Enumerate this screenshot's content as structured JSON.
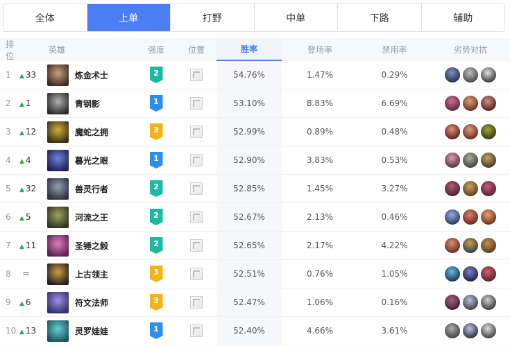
{
  "tabs": [
    {
      "label": "全体",
      "active": false
    },
    {
      "label": "上单",
      "active": true
    },
    {
      "label": "打野",
      "active": false
    },
    {
      "label": "中单",
      "active": false
    },
    {
      "label": "下路",
      "active": false
    },
    {
      "label": "辅助",
      "active": false
    }
  ],
  "headers": {
    "rank": "排位",
    "hero": "英雄",
    "tier": "强度",
    "position": "位置",
    "winrate": "胜率",
    "pickrate": "登场率",
    "banrate": "禁用率",
    "counters": "劣势对抗"
  },
  "colors": {
    "accent": "#4b7ef0",
    "tier1": "#2b8ff0",
    "tier2": "#1fb8a3",
    "tier3": "#f2b21a",
    "trend_up": "#2aa853"
  },
  "rows": [
    {
      "rank": "1",
      "trend": "up",
      "change": "33",
      "name": "炼金术士",
      "tier": "2",
      "winrate": "54.76%",
      "pickrate": "1.47%",
      "banrate": "0.29%",
      "avatar_colors": [
        "#3a2a2a",
        "#c9a27a"
      ],
      "counter_colors": [
        [
          "#2a3050",
          "#8090c0"
        ],
        [
          "#4a4a4a",
          "#c0c0c0"
        ],
        [
          "#3b3b3b",
          "#e0e0e0"
        ]
      ]
    },
    {
      "rank": "2",
      "trend": "up",
      "change": "1",
      "name": "青钢影",
      "tier": "1",
      "winrate": "53.10%",
      "pickrate": "8.83%",
      "banrate": "6.69%",
      "avatar_colors": [
        "#2b2b2b",
        "#b0b0b0"
      ],
      "counter_colors": [
        [
          "#5a2840",
          "#d07090"
        ],
        [
          "#6a3020",
          "#e0a070"
        ],
        [
          "#5a2020",
          "#d09080"
        ]
      ]
    },
    {
      "rank": "3",
      "trend": "up",
      "change": "12",
      "name": "魔蛇之拥",
      "tier": "3",
      "winrate": "52.99%",
      "pickrate": "0.89%",
      "banrate": "0.48%",
      "avatar_colors": [
        "#3a3010",
        "#d0b040"
      ],
      "counter_colors": [
        [
          "#5a2020",
          "#e09070"
        ],
        [
          "#6a2a20",
          "#e0a080"
        ],
        [
          "#3a3a10",
          "#a0a040"
        ]
      ]
    },
    {
      "rank": "4",
      "trend": "up",
      "change": "4",
      "name": "暮光之眼",
      "tier": "1",
      "winrate": "52.90%",
      "pickrate": "3.83%",
      "banrate": "0.53%",
      "avatar_colors": [
        "#202050",
        "#7080e0"
      ],
      "counter_colors": [
        [
          "#5a3040",
          "#e0a0b0"
        ],
        [
          "#404040",
          "#b0b0a0"
        ],
        [
          "#4a3a20",
          "#c0a070"
        ]
      ]
    },
    {
      "rank": "5",
      "trend": "up",
      "change": "32",
      "name": "兽灵行者",
      "tier": "2",
      "winrate": "52.85%",
      "pickrate": "1.45%",
      "banrate": "3.27%",
      "avatar_colors": [
        "#303040",
        "#90a0b0"
      ],
      "counter_colors": [
        [
          "#4a2030",
          "#b06070"
        ],
        [
          "#5a4020",
          "#d0a060"
        ],
        [
          "#5a2030",
          "#c06080"
        ]
      ]
    },
    {
      "rank": "6",
      "trend": "up",
      "change": "5",
      "name": "河流之王",
      "tier": "2",
      "winrate": "52.67%",
      "pickrate": "2.13%",
      "banrate": "0.46%",
      "avatar_colors": [
        "#303520",
        "#a0a060"
      ],
      "counter_colors": [
        [
          "#2a3a5a",
          "#90b0e0"
        ],
        [
          "#6a2820",
          "#e08060"
        ],
        [
          "#6a3020",
          "#f0a070"
        ]
      ]
    },
    {
      "rank": "7",
      "trend": "up",
      "change": "11",
      "name": "圣锤之毅",
      "tier": "2",
      "winrate": "52.65%",
      "pickrate": "2.17%",
      "banrate": "4.22%",
      "avatar_colors": [
        "#5a2050",
        "#e080c0"
      ],
      "counter_colors": [
        [
          "#6a2a20",
          "#e09070"
        ],
        [
          "#2a4050",
          "#d0a040"
        ],
        [
          "#5a4020",
          "#c09050"
        ]
      ]
    },
    {
      "rank": "8",
      "trend": "eq",
      "change": "=",
      "name": "上古领主",
      "tier": "3",
      "winrate": "52.51%",
      "pickrate": "0.76%",
      "banrate": "1.05%",
      "avatar_colors": [
        "#202020",
        "#d0a040"
      ],
      "counter_colors": [
        [
          "#20305a",
          "#60c0e0"
        ],
        [
          "#202040",
          "#8080d0"
        ],
        [
          "#5a2030",
          "#d06070"
        ]
      ]
    },
    {
      "rank": "9",
      "trend": "up",
      "change": "6",
      "name": "符文法师",
      "tier": "3",
      "winrate": "52.47%",
      "pickrate": "1.06%",
      "banrate": "0.16%",
      "avatar_colors": [
        "#303070",
        "#a090e0"
      ],
      "counter_colors": [
        [
          "#3a2030",
          "#b06080"
        ],
        [
          "#404050",
          "#c0c0d0"
        ],
        [
          "#3a3a3a",
          "#d0d0d0"
        ]
      ]
    },
    {
      "rank": "10",
      "trend": "up",
      "change": "13",
      "name": "灵罗娃娃",
      "tier": "1",
      "winrate": "52.40%",
      "pickrate": "4.66%",
      "banrate": "3.61%",
      "avatar_colors": [
        "#205060",
        "#60d0d0"
      ],
      "counter_colors": [
        [
          "#404040",
          "#b0b0b0"
        ],
        [
          "#303040",
          "#c0c0e0"
        ],
        [
          "#404040",
          "#e0e0e0"
        ]
      ]
    }
  ]
}
